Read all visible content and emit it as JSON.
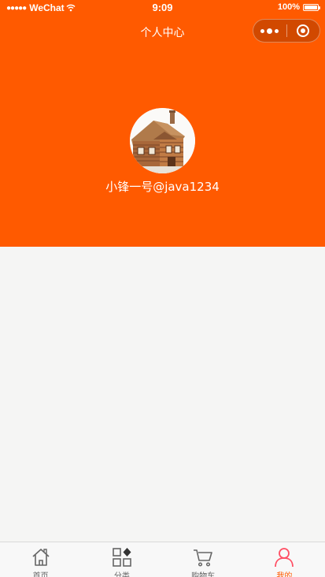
{
  "status_bar": {
    "signal": "●●●●●",
    "carrier": "WeChat",
    "time": "9:09",
    "battery_text": "100%",
    "battery_level": 1.0
  },
  "nav": {
    "title": "个人中心"
  },
  "profile": {
    "username": "小锋一号@java1234"
  },
  "tabbar": {
    "items": [
      {
        "label": "首页",
        "icon": "home-icon"
      },
      {
        "label": "分类",
        "icon": "category-icon"
      },
      {
        "label": "购物车",
        "icon": "cart-icon"
      },
      {
        "label": "我的",
        "icon": "user-icon"
      }
    ],
    "active_index": 3
  },
  "colors": {
    "brand": "#ff5a00",
    "page_background": "#f5f5f4",
    "tab_inactive": "#666666",
    "tab_active": "#ff5a00"
  }
}
